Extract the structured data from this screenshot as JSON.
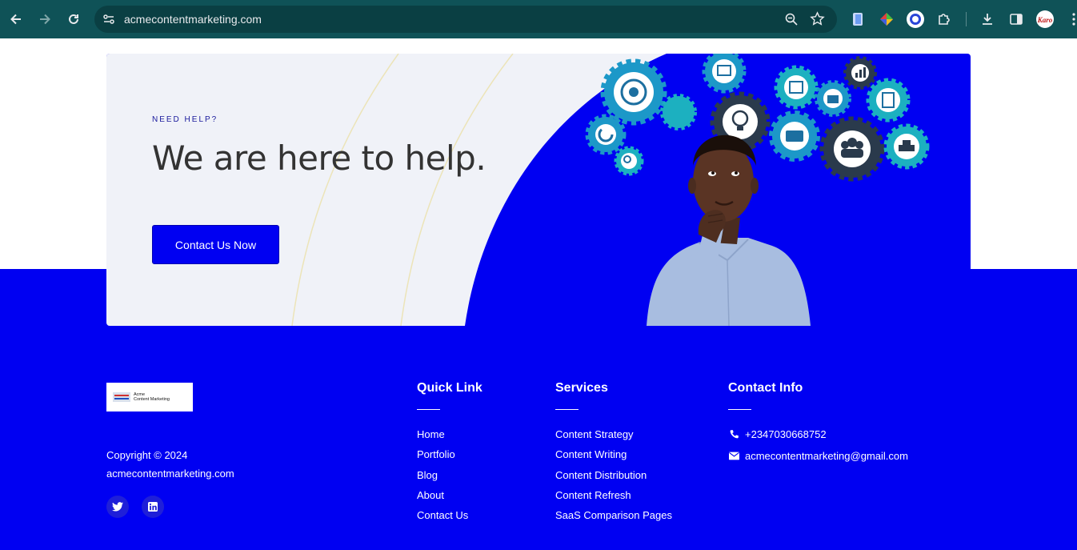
{
  "browser": {
    "url": "acmecontentmarketing.com",
    "profile_label": "Karo"
  },
  "banner": {
    "eyebrow": "NEED HELP?",
    "headline": "We are here to help.",
    "cta_label": "Contact Us Now"
  },
  "footer": {
    "logo": {
      "line1": "Acme",
      "line2": "Content Marketing"
    },
    "copyright": "Copyright © 2024",
    "domain": "acmecontentmarketing.com",
    "social": [
      "twitter-icon",
      "linkedin-icon"
    ],
    "quick_link": {
      "title": "Quick Link",
      "items": [
        "Home",
        "Portfolio",
        "Blog",
        "About",
        "Contact Us"
      ]
    },
    "services": {
      "title": "Services",
      "items": [
        "Content Strategy",
        "Content Writing",
        "Content Distribution",
        "Content Refresh",
        "SaaS Comparison Pages"
      ]
    },
    "contact": {
      "title": "Contact Info",
      "phone": "+2347030668752",
      "email": "acmecontentmarketing@gmail.com"
    }
  },
  "colors": {
    "brand_blue": "#0000f2",
    "chrome_teal": "#0f5257",
    "panel": "#f0f2f8"
  }
}
